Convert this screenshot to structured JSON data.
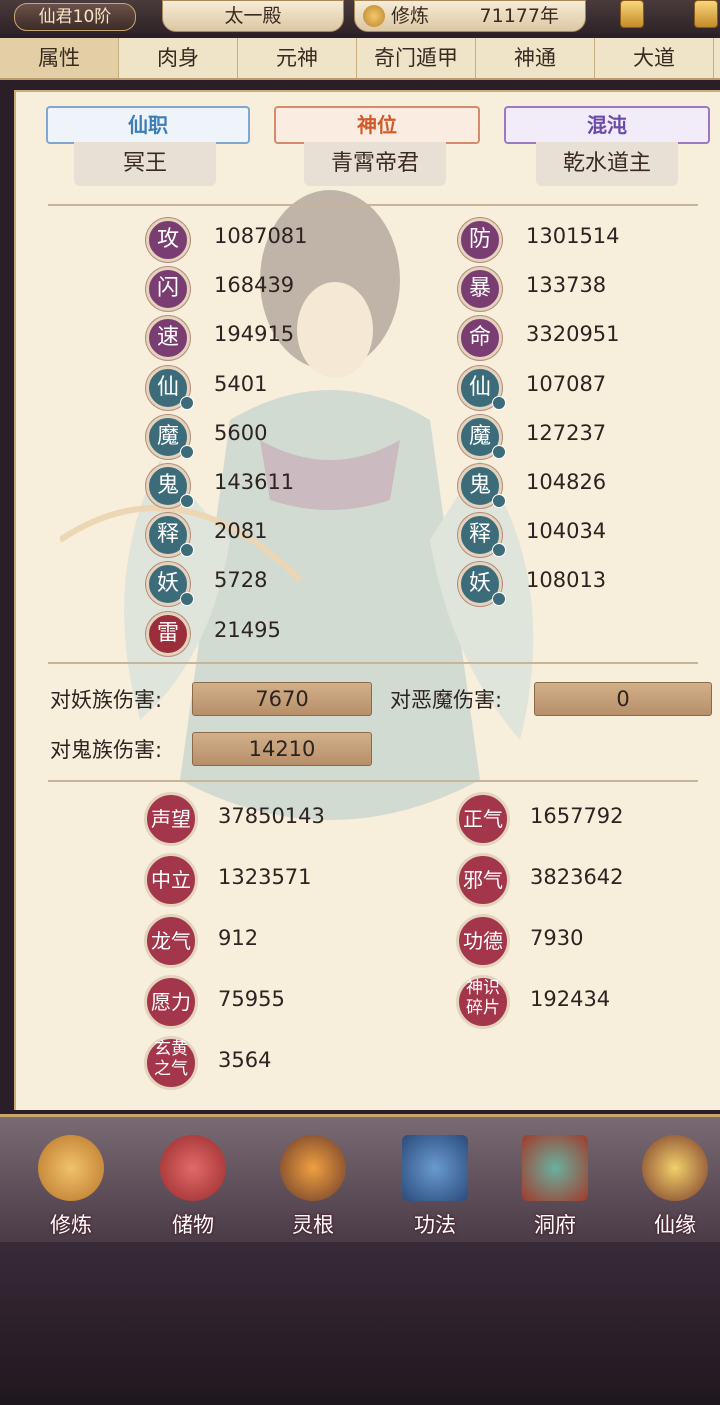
{
  "header": {
    "rank_label": "仙君10阶",
    "realm": "太一殿",
    "cultivation_label": "修炼",
    "cultivation_value": "71177年"
  },
  "tabs": [
    "属性",
    "肉身",
    "元神",
    "奇门遁甲",
    "神通",
    "大道"
  ],
  "titles": [
    {
      "heading": "仙职",
      "value": "冥王",
      "color": "#3d7eb8"
    },
    {
      "heading": "神位",
      "value": "青霄帝君",
      "color": "#d05a2a"
    },
    {
      "heading": "混沌",
      "value": "乾水道主",
      "color": "#6b4aa8"
    }
  ],
  "stats_left": [
    {
      "icon": "攻",
      "value": "1087081"
    },
    {
      "icon": "闪",
      "value": "168439"
    },
    {
      "icon": "速",
      "value": "194915"
    },
    {
      "icon": "仙",
      "value": "5401"
    },
    {
      "icon": "魔",
      "value": "5600"
    },
    {
      "icon": "鬼",
      "value": "143611"
    },
    {
      "icon": "释",
      "value": "2081"
    },
    {
      "icon": "妖",
      "value": "5728"
    },
    {
      "icon": "雷",
      "value": "21495"
    }
  ],
  "stats_right": [
    {
      "icon": "防",
      "value": "1301514"
    },
    {
      "icon": "暴",
      "value": "133738"
    },
    {
      "icon": "命",
      "value": "3320951"
    },
    {
      "icon": "仙",
      "value": "107087"
    },
    {
      "icon": "魔",
      "value": "127237"
    },
    {
      "icon": "鬼",
      "value": "104826"
    },
    {
      "icon": "释",
      "value": "104034"
    },
    {
      "icon": "妖",
      "value": "108013"
    }
  ],
  "damage": {
    "vs_yao_label": "对妖族伤害:",
    "vs_yao_value": "7670",
    "vs_demon_label": "对恶魔伤害:",
    "vs_demon_value": "0",
    "vs_ghost_label": "对鬼族伤害:",
    "vs_ghost_value": "14210"
  },
  "misc_left": [
    {
      "icon": "声望",
      "value": "37850143"
    },
    {
      "icon": "中立",
      "value": "1323571"
    },
    {
      "icon": "龙气",
      "value": "912"
    },
    {
      "icon": "愿力",
      "value": "75955"
    },
    {
      "icon": "玄黄之气",
      "value": "3564"
    }
  ],
  "misc_right": [
    {
      "icon": "正气",
      "value": "1657792"
    },
    {
      "icon": "邪气",
      "value": "3823642"
    },
    {
      "icon": "功德",
      "value": "7930"
    },
    {
      "icon": "神识碎片",
      "value": "192434"
    }
  ],
  "bottom_nav": [
    "修炼",
    "储物",
    "灵根",
    "功法",
    "洞府",
    "仙缘"
  ]
}
